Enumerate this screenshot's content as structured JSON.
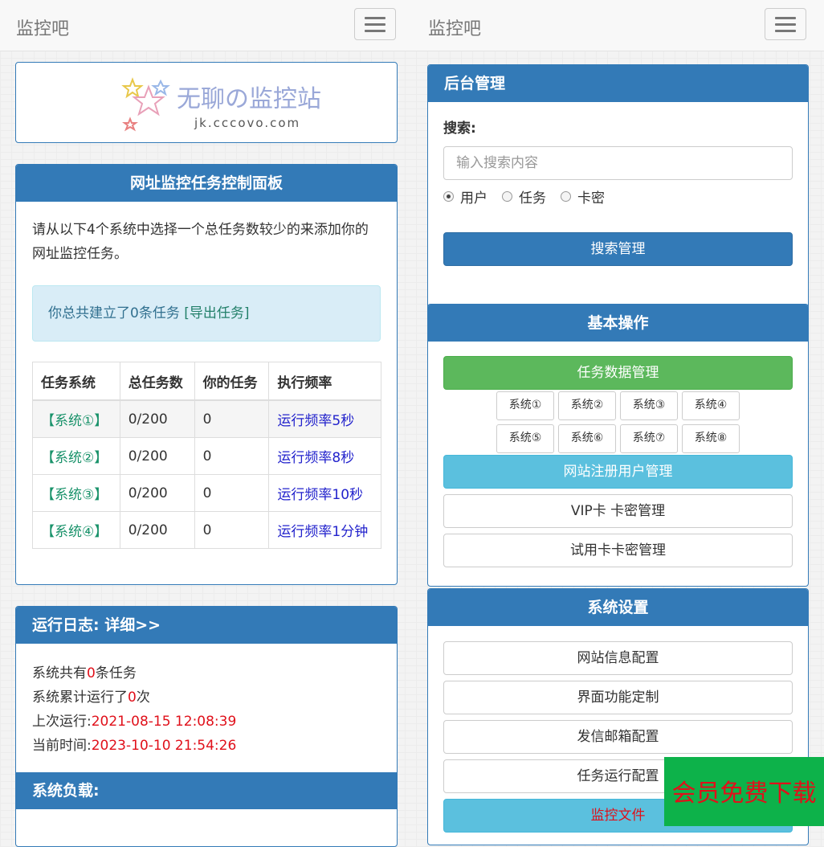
{
  "nav": {
    "brand_left": "监控吧",
    "brand_right": "监控吧"
  },
  "logo": {
    "title": "无聊の监控站",
    "domain": "jk.cccovo.com"
  },
  "control_panel": {
    "title": "网址监控任务控制面板",
    "intro": "请从以下4个系统中选择一个总任务数较少的来添加你的网址监控任务。",
    "alert_text": "你总共建立了0条任务 ",
    "export_link": "[导出任务]",
    "table": {
      "headers": [
        "任务系统",
        "总任务数",
        "你的任务",
        "执行频率"
      ],
      "rows": [
        {
          "system": "【系统①】",
          "total": "0/200",
          "mine": "0",
          "freq": "运行频率5秒"
        },
        {
          "system": "【系统②】",
          "total": "0/200",
          "mine": "0",
          "freq": "运行频率8秒"
        },
        {
          "system": "【系统③】",
          "total": "0/200",
          "mine": "0",
          "freq": "运行频率10秒"
        },
        {
          "system": "【系统④】",
          "total": "0/200",
          "mine": "0",
          "freq": "运行频率1分钟"
        }
      ]
    }
  },
  "log": {
    "title": "运行日志: 详细>>",
    "line1_a": "系统共有",
    "line1_num": "0",
    "line1_b": "条任务",
    "line2_a": "系统累计运行了",
    "line2_num": "0",
    "line2_b": "次",
    "line3_label": "上次运行:",
    "line3_value": "2021-08-15 12:08:39",
    "line4_label": "当前时间:",
    "line4_value": "2023-10-10 21:54:26",
    "load_title": "系统负载:"
  },
  "admin": {
    "title": "后台管理",
    "search_label": "搜索:",
    "search_placeholder": "输入搜索内容",
    "radios": [
      "用户",
      "任务",
      "卡密"
    ],
    "search_button": "搜索管理"
  },
  "ops": {
    "title": "基本操作",
    "task_data": "任务数据管理",
    "systems": [
      "系统①",
      "系统②",
      "系统③",
      "系统④",
      "系统⑤",
      "系统⑥",
      "系统⑦",
      "系统⑧"
    ],
    "user_mgmt": "网站注册用户管理",
    "vip_card": "VIP卡 卡密管理",
    "trial_card": "试用卡卡密管理"
  },
  "settings": {
    "title": "系统设置",
    "items": [
      "网站信息配置",
      "界面功能定制",
      "发信邮箱配置",
      "任务运行配置"
    ],
    "monitor_file": "监控文件"
  },
  "promo": {
    "text": "会员免费下载"
  },
  "colors": {
    "primary": "#337ab7",
    "success": "#5cb85c",
    "info": "#5bc0de",
    "danger": "#e0101a",
    "promo_bg": "#0db24a"
  }
}
